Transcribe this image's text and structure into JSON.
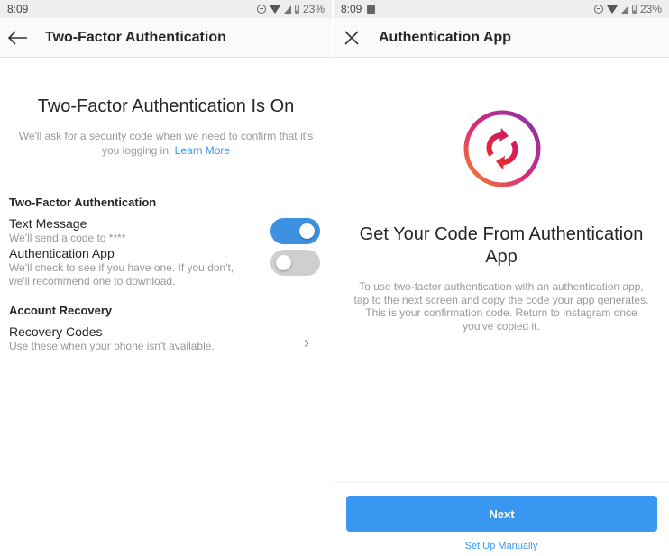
{
  "left": {
    "status_bar": {
      "time": "8:09",
      "battery": "23%"
    },
    "app_bar": {
      "back_icon": "arrow-left-icon",
      "title": "Two-Factor Authentication"
    },
    "headline": "Two-Factor Authentication Is On",
    "description": "We'll ask for a security code when we need to confirm that it's you logging in.",
    "learn_more": "Learn More",
    "two_factor_section": {
      "title": "Two-Factor Authentication",
      "items": [
        {
          "label": "Text Message",
          "sub": "We'll send a code to ****",
          "enabled": true
        },
        {
          "label": "Authentication App",
          "sub": "We'll check to see if you have one. If you don't, we'll recommend one to download.",
          "enabled": false
        }
      ]
    },
    "recovery_section": {
      "title": "Account Recovery",
      "items": [
        {
          "label": "Recovery Codes",
          "sub": "Use these when your phone isn't available.",
          "chevron": "›"
        }
      ]
    }
  },
  "right": {
    "status_bar": {
      "time": "8:09",
      "battery": "23%"
    },
    "app_bar": {
      "close_icon": "close-icon",
      "title": "Authentication App"
    },
    "icon": "sync-icon",
    "headline": "Get Your Code From Authentication App",
    "description": "To use two-factor authentication with an authentication app, tap to the next screen and copy the code your app generates. This is your confirmation code. Return to Instagram once you've copied it.",
    "next_button": "Next",
    "manual_link": "Set Up Manually"
  },
  "colors": {
    "accent": "#3897f0",
    "toggle_on": "#3d91e0",
    "toggle_off": "#cfcfcf",
    "gradient": [
      "#f58529",
      "#dd2a7b",
      "#8134af"
    ]
  }
}
